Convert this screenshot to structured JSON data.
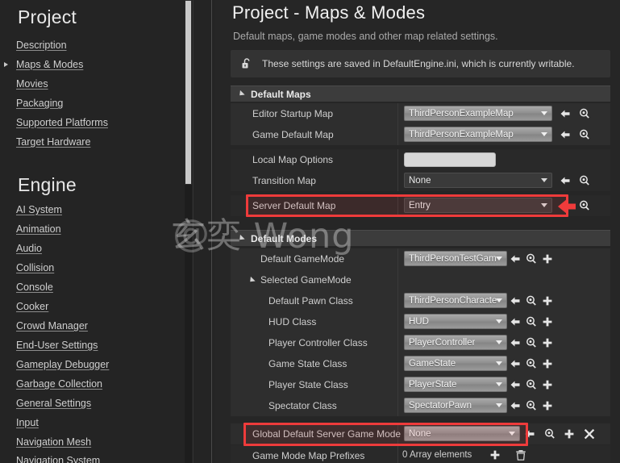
{
  "sidebar": {
    "groups": [
      {
        "title": "Project",
        "items": [
          {
            "label": "Description",
            "expandable": false
          },
          {
            "label": "Maps & Modes",
            "expandable": true
          },
          {
            "label": "Movies",
            "expandable": false
          },
          {
            "label": "Packaging",
            "expandable": false
          },
          {
            "label": "Supported Platforms",
            "expandable": false
          },
          {
            "label": "Target Hardware",
            "expandable": false
          }
        ]
      },
      {
        "title": "Engine",
        "items": [
          {
            "label": "AI System",
            "expandable": false
          },
          {
            "label": "Animation",
            "expandable": false
          },
          {
            "label": "Audio",
            "expandable": false
          },
          {
            "label": "Collision",
            "expandable": false
          },
          {
            "label": "Console",
            "expandable": false
          },
          {
            "label": "Cooker",
            "expandable": false
          },
          {
            "label": "Crowd Manager",
            "expandable": false
          },
          {
            "label": "End-User Settings",
            "expandable": false
          },
          {
            "label": "Gameplay Debugger",
            "expandable": false
          },
          {
            "label": "Garbage Collection",
            "expandable": false
          },
          {
            "label": "General Settings",
            "expandable": false
          },
          {
            "label": "Input",
            "expandable": false
          },
          {
            "label": "Navigation Mesh",
            "expandable": false
          },
          {
            "label": "Navigation System",
            "expandable": false
          }
        ]
      }
    ]
  },
  "main": {
    "title": "Project - Maps & Modes",
    "subtitle": "Default maps, game modes and other map related settings.",
    "notice": "These settings are saved in DefaultEngine.ini, which is currently writable.",
    "sections": [
      {
        "name": "Default Maps",
        "rows": [
          {
            "label": "Editor Startup Map",
            "value": "ThirdPersonExampleMap",
            "control": "combo",
            "icons": [
              "reset-arrow",
              "browse-magnifier"
            ]
          },
          {
            "label": "Game Default Map",
            "value": "ThirdPersonExampleMap",
            "control": "combo",
            "icons": [
              "reset-arrow",
              "browse-magnifier"
            ]
          },
          {
            "label": "Local Map Options",
            "value": "",
            "control": "text",
            "icons": []
          },
          {
            "label": "Transition Map",
            "value": "None",
            "control": "combo",
            "icons": [
              "reset-arrow",
              "browse-magnifier"
            ]
          },
          {
            "label": "Server Default Map",
            "value": "Entry",
            "control": "combo-flat",
            "icons": [
              "reset-arrow",
              "browse-magnifier"
            ],
            "highlighted": true
          }
        ]
      },
      {
        "name": "Default Modes",
        "rows": [
          {
            "label": "Default GameMode",
            "value": "ThirdPersonTestGam",
            "control": "combo",
            "icons": [
              "reset-arrow",
              "browse-magnifier",
              "plus"
            ]
          },
          {
            "label": "Selected GameMode",
            "value": "",
            "control": "group",
            "icons": []
          },
          {
            "label": "Default Pawn Class",
            "value": "ThirdPersonCharacte",
            "control": "combo",
            "icons": [
              "reset-arrow",
              "browse-magnifier",
              "plus"
            ]
          },
          {
            "label": "HUD Class",
            "value": "HUD",
            "control": "combo",
            "icons": [
              "reset-arrow",
              "browse-magnifier",
              "plus"
            ]
          },
          {
            "label": "Player Controller Class",
            "value": "PlayerController",
            "control": "combo",
            "icons": [
              "reset-arrow",
              "browse-magnifier",
              "plus"
            ]
          },
          {
            "label": "Game State Class",
            "value": "GameState",
            "control": "combo",
            "icons": [
              "reset-arrow",
              "browse-magnifier",
              "plus"
            ]
          },
          {
            "label": "Player State Class",
            "value": "PlayerState",
            "control": "combo",
            "icons": [
              "reset-arrow",
              "browse-magnifier",
              "plus"
            ]
          },
          {
            "label": "Spectator Class",
            "value": "SpectatorPawn",
            "control": "combo",
            "icons": [
              "reset-arrow",
              "browse-magnifier",
              "plus"
            ]
          },
          {
            "label": "Global Default Server Game Mode",
            "value": "None",
            "control": "combo",
            "icons": [
              "reset-arrow",
              "browse-magnifier",
              "plus",
              "clear-x"
            ],
            "highlighted": true
          },
          {
            "label": "Game Mode Map Prefixes",
            "value": "0 Array elements",
            "control": "array",
            "icons": [
              "plus",
              "trash"
            ]
          }
        ]
      }
    ]
  },
  "annotations": {
    "highlight_color": "#ef3b3b",
    "pointer_arrow": "left-pointing-arrow-at-server-default-map"
  },
  "watermark": {
    "at": "@",
    "text": "玄奕 Wong"
  }
}
